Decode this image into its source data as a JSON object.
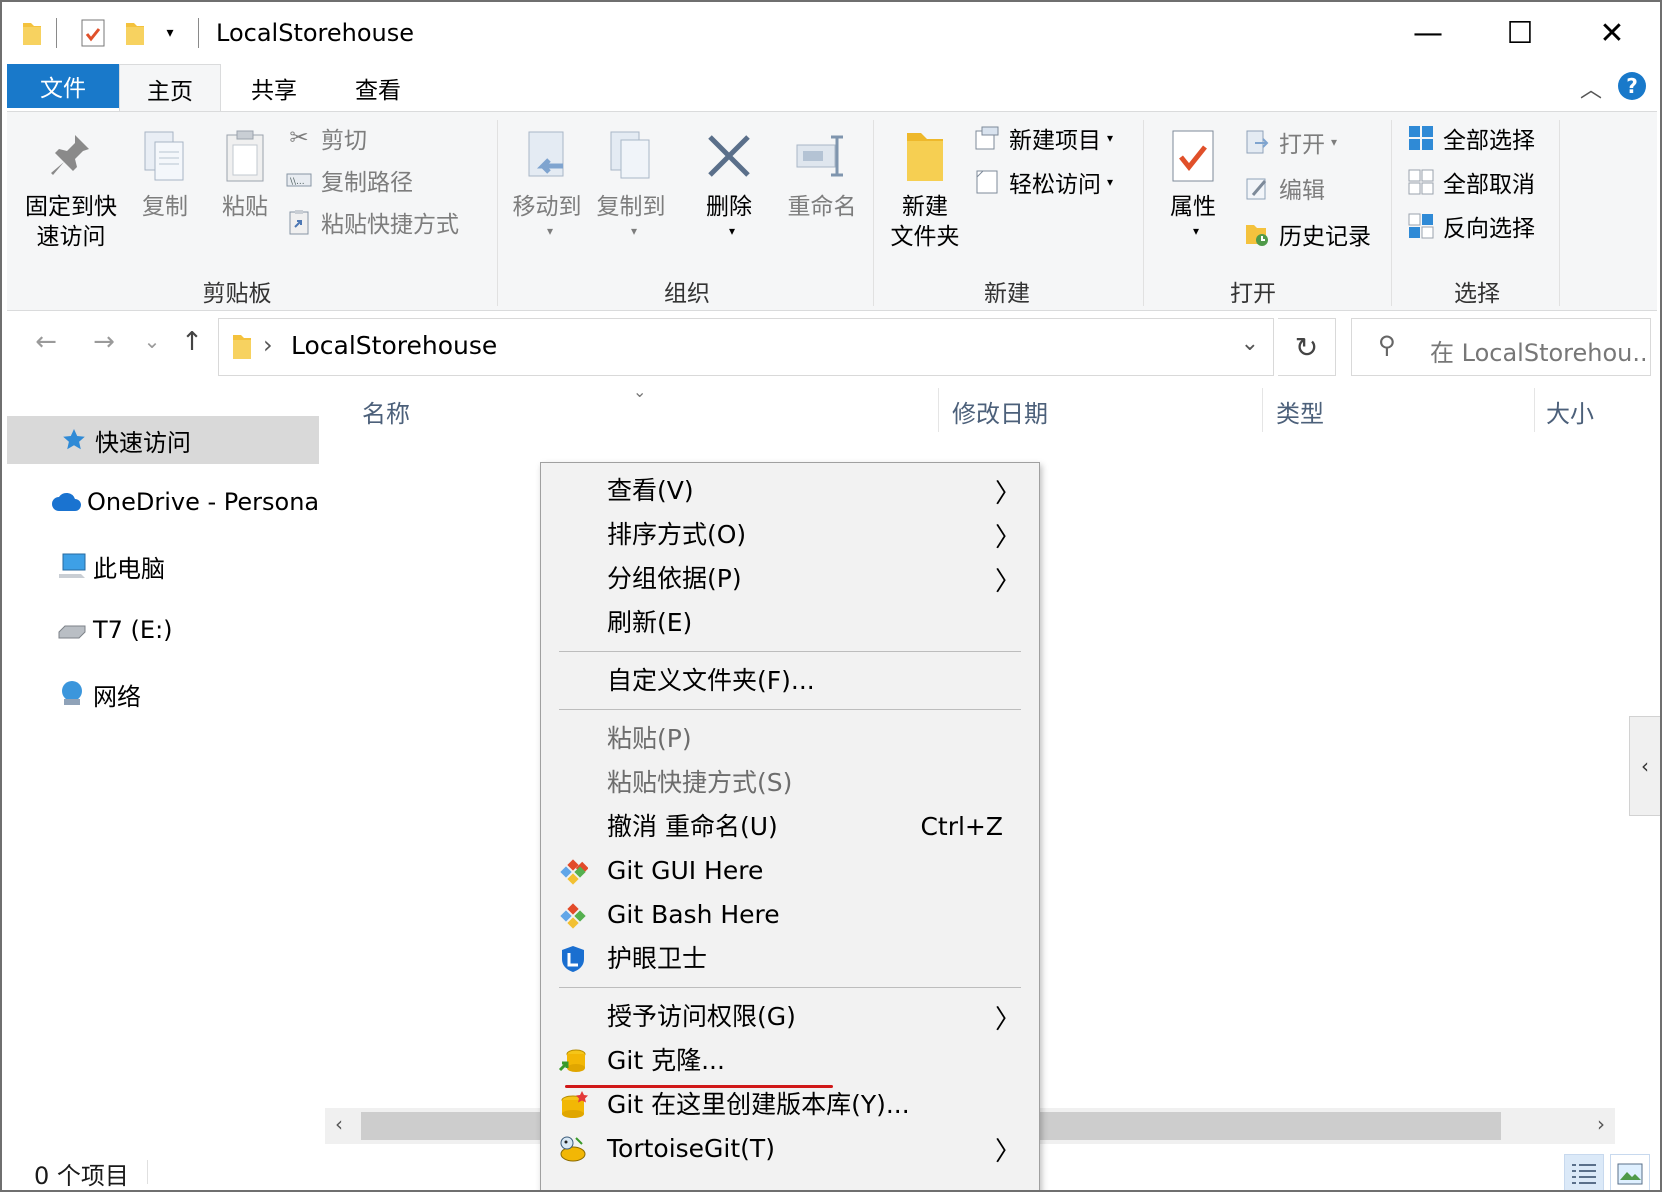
{
  "window": {
    "title": "LocalStorehouse",
    "minimize_glyph": "—",
    "maximize_glyph": "☐",
    "close_glyph": "✕"
  },
  "ribbon_tabs": {
    "file": "文件",
    "home": "主页",
    "share": "共享",
    "view": "查看",
    "help_glyph": "?",
    "collapse_glyph": "︿"
  },
  "ribbon": {
    "clipboard": {
      "label": "剪贴板",
      "pin_line1": "固定到快",
      "pin_line2": "速访问",
      "copy": "复制",
      "paste": "粘贴",
      "cut": "剪切",
      "copy_path": "复制路径",
      "paste_shortcut": "粘贴快捷方式"
    },
    "organize": {
      "label": "组织",
      "move_to": "移动到",
      "copy_to": "复制到",
      "delete": "删除",
      "rename": "重命名"
    },
    "new": {
      "label": "新建",
      "new_folder_line1": "新建",
      "new_folder_line2": "文件夹",
      "new_item": "新建项目",
      "easy_access": "轻松访问"
    },
    "open": {
      "label": "打开",
      "properties": "属性",
      "open": "打开",
      "edit": "编辑",
      "history": "历史记录"
    },
    "select": {
      "label": "选择",
      "select_all": "全部选择",
      "select_none": "全部取消",
      "invert": "反向选择"
    }
  },
  "address_bar": {
    "back_glyph": "←",
    "forward_glyph": "→",
    "recent_glyph": "⌄",
    "up_glyph": "↑",
    "path": "LocalStorehouse",
    "separator": "›",
    "refresh_glyph": "↻",
    "search_placeholder": "在 LocalStorehou..."
  },
  "nav_pane": {
    "items": [
      {
        "label": "快速访问",
        "icon": "star-icon"
      },
      {
        "label": "OneDrive - Persona",
        "icon": "cloud-icon"
      },
      {
        "label": "此电脑",
        "icon": "computer-icon"
      },
      {
        "label": "T7 (E:)",
        "icon": "drive-icon"
      },
      {
        "label": "网络",
        "icon": "network-icon"
      }
    ]
  },
  "columns": {
    "name": "名称",
    "date": "修改日期",
    "type": "类型",
    "size": "大小"
  },
  "status": {
    "count": "0 个项目"
  },
  "context_menu": {
    "items": [
      {
        "label": "查看(V)",
        "submenu": true
      },
      {
        "label": "排序方式(O)",
        "submenu": true
      },
      {
        "label": "分组依据(P)",
        "submenu": true
      },
      {
        "label": "刷新(E)"
      },
      {
        "label": "自定义文件夹(F)..."
      },
      {
        "label": "粘贴(P)",
        "disabled": true
      },
      {
        "label": "粘贴快捷方式(S)",
        "disabled": true
      },
      {
        "label": "撤消 重命名(U)",
        "shortcut": "Ctrl+Z"
      },
      {
        "label": "Git GUI Here",
        "icon": "git-gui-icon"
      },
      {
        "label": "Git Bash Here",
        "icon": "git-bash-icon"
      },
      {
        "label": "护眼卫士",
        "icon": "eye-guard-icon"
      },
      {
        "label": "授予访问权限(G)",
        "submenu": true
      },
      {
        "label": "Git 克隆...",
        "icon": "tortoise-clone-icon"
      },
      {
        "label": "Git 在这里创建版本库(Y)...",
        "icon": "tortoise-create-repo-icon"
      },
      {
        "label": "TortoiseGit(T)",
        "icon": "tortoisegit-icon",
        "submenu": true
      }
    ],
    "submenu_glyph": "〉",
    "highlight_color": "#d01818"
  },
  "colors": {
    "accent": "#1979ca",
    "folder": "#f4c23d"
  }
}
